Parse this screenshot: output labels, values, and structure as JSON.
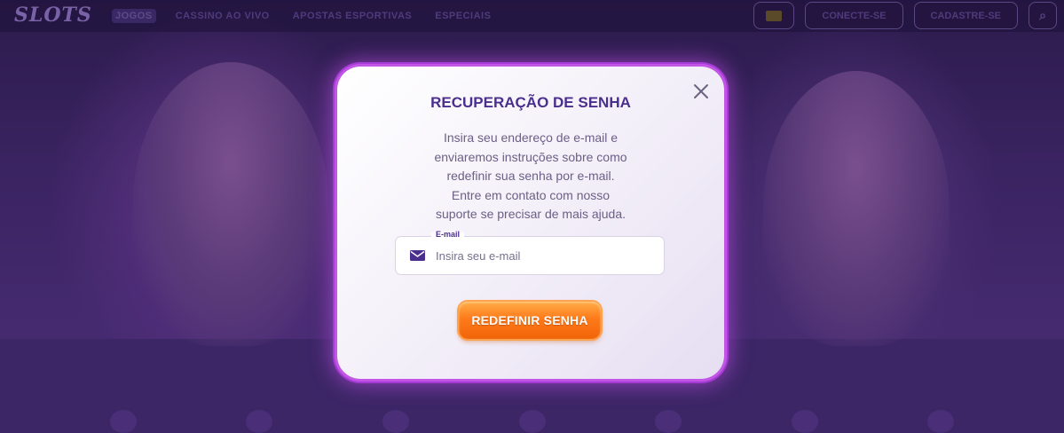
{
  "background": {
    "logo_text": "SLOTS",
    "nav": [
      "JOGOS",
      "CASSINO AO VIVO",
      "APOSTAS ESPORTIVAS",
      "ESPECIAIS"
    ],
    "login_label": "CONECTE-SE",
    "register_label": "CADASTRE-SE"
  },
  "modal": {
    "title": "RECUPERAÇÃO DE SENHA",
    "description_lines": [
      "Insira seu endereço de e-mail e",
      "enviaremos instruções sobre como",
      "redefinir sua senha por e-mail.",
      "Entre em contato com nosso",
      "suporte se precisar de mais ajuda."
    ],
    "email": {
      "label": "E-mail",
      "placeholder": "Insira seu e-mail",
      "value": ""
    },
    "submit_label": "REDEFINIR SENHA",
    "close_icon": "close-icon"
  },
  "colors": {
    "title": "#4b2f8e",
    "button": "#ff7a1a",
    "modal_glow": "#c255e6"
  }
}
